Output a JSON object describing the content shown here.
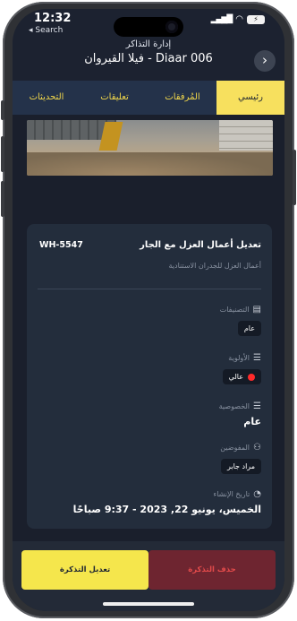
{
  "status_bar": {
    "time": "12:32",
    "back_label": "◂ Search",
    "battery": "⚡"
  },
  "header": {
    "subtitle": "إدارة التذاكر",
    "title": "فيلا القيروان - Diaar 006",
    "nav_icon": "chevron-right-icon"
  },
  "tabs": [
    {
      "label": "رئيسي",
      "active": true
    },
    {
      "label": "المُرفقات",
      "active": false
    },
    {
      "label": "تعليقات",
      "active": false
    },
    {
      "label": "التحديثات",
      "active": false
    }
  ],
  "ticket": {
    "title": "تعديل أعمال العزل مع الجار",
    "code": "WH-5547",
    "description": "أعمال العزل للجدران الاستنادية",
    "category": {
      "label": "التصنيفات",
      "value": "عام"
    },
    "priority": {
      "label": "الأولوية",
      "value": "عالي",
      "color": "#ff2a2a"
    },
    "privacy": {
      "label": "الخصوصية",
      "value": "عام"
    },
    "assignees": {
      "label": "المفوضين",
      "value": "مراد جابر"
    },
    "created": {
      "label": "تاريخ الإنشاء",
      "value": "الخميس، يونيو 22, 2023 - 9:37 صباحًا"
    }
  },
  "actions": {
    "edit_label": "تعديل التذكرة",
    "delete_label": "حذف التذكرة"
  },
  "colors": {
    "accent": "#f5e64c",
    "danger": "#e14a4a",
    "background": "#1c2230"
  }
}
